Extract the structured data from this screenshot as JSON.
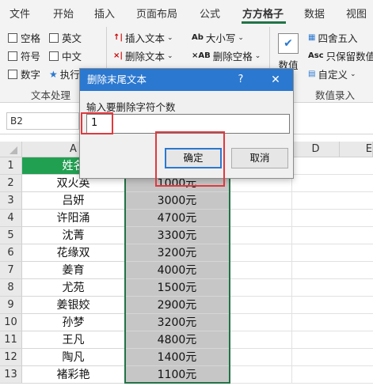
{
  "menubar": {
    "items": [
      "文件",
      "开始",
      "插入",
      "页面布局",
      "公式",
      "方方格子",
      "数据",
      "视图"
    ],
    "active_index": 5
  },
  "ribbon": {
    "checks": [
      "空格",
      "英文",
      "符号",
      "中文",
      "数字",
      "执行"
    ],
    "buttons": [
      "插入文本",
      "删除文本",
      "大小写",
      "删除空格"
    ],
    "right_buttons": [
      "四舍五入",
      "只保留数值",
      "自定义"
    ],
    "large_button": "数值",
    "group_labels": [
      "文本处理",
      "数值录入"
    ],
    "accent": "#217346"
  },
  "formula_bar": {
    "name_box": "B2"
  },
  "grid": {
    "columns": [
      "A",
      "D",
      "E"
    ],
    "rows": [
      "1",
      "2",
      "3",
      "4",
      "5",
      "6",
      "7",
      "8",
      "9",
      "10",
      "11",
      "12",
      "13"
    ],
    "header_partial": "姓名",
    "names": [
      "双火英",
      "吕妍",
      "许阳涌",
      "沈菁",
      "花缘双",
      "姜育",
      "尤苑",
      "姜银姣",
      "孙梦",
      "王凡",
      "陶凡",
      "褚彩艳"
    ],
    "amounts": [
      "1000元",
      "3000元",
      "4700元",
      "3300元",
      "3200元",
      "4000元",
      "1500元",
      "2900元",
      "3200元",
      "4800元",
      "1400元",
      "1100元"
    ],
    "header_color": "#22a052",
    "selection_fill": "#c6c6c6"
  },
  "dialog": {
    "title": "删除末尾文本",
    "help": "?",
    "close": "✕",
    "label": "输入要删除字符个数",
    "input_value": "1",
    "ok": "确定",
    "cancel": "取消",
    "title_color": "#2b78d0",
    "highlight_color": "#e0393e"
  }
}
